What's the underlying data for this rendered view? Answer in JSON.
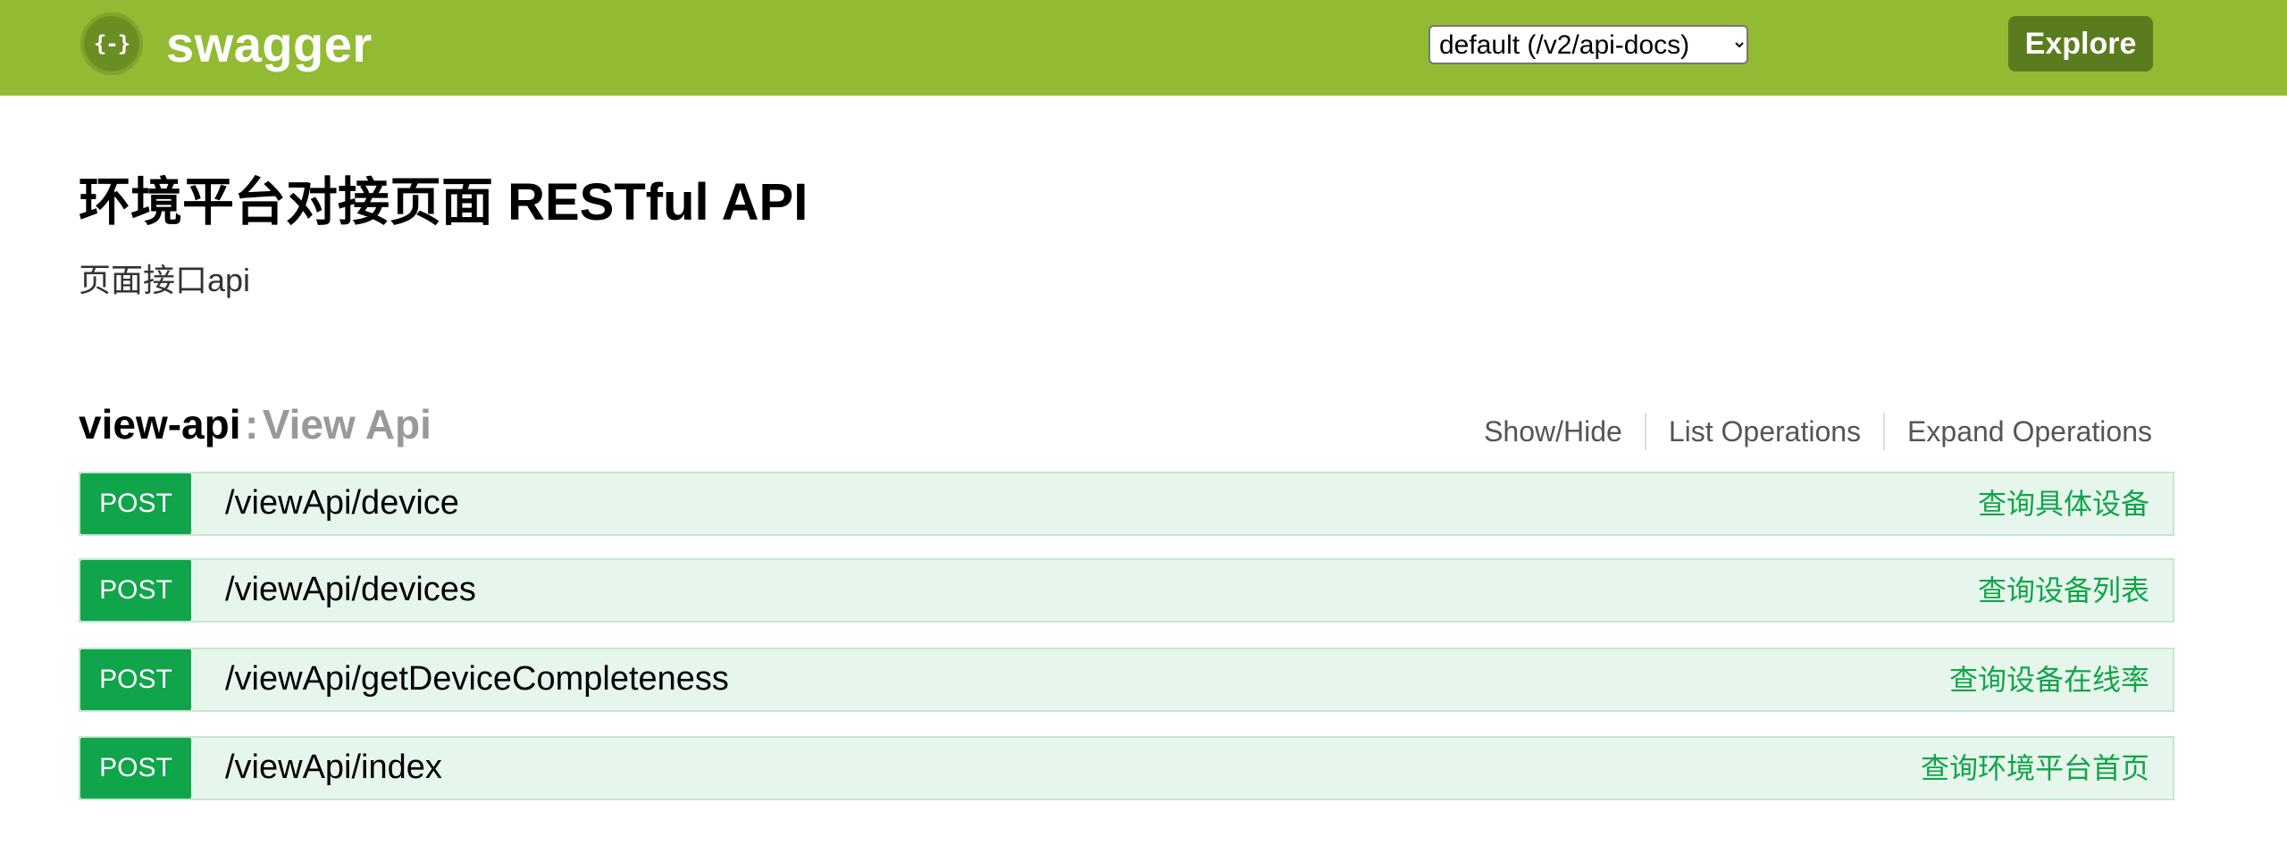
{
  "header": {
    "logo_icon_text": "{-}",
    "logo_text": "swagger",
    "spec_select": {
      "selected": "default (/v2/api-docs)",
      "options": [
        "default (/v2/api-docs)"
      ]
    },
    "explore_label": "Explore",
    "colors": {
      "bar": "#92bb33",
      "explore_button": "#5b7c1e"
    }
  },
  "info": {
    "title": "环境平台对接页面 RESTful API",
    "description": "页面接口api"
  },
  "resource": {
    "name": "view-api",
    "separator": ":",
    "description": "View Api",
    "controls": {
      "show_hide": "Show/Hide",
      "list_operations": "List Operations",
      "expand_operations": "Expand Operations"
    }
  },
  "operations": [
    {
      "method": "POST",
      "path": "/viewApi/device",
      "summary": "查询具体设备"
    },
    {
      "method": "POST",
      "path": "/viewApi/devices",
      "summary": "查询设备列表"
    },
    {
      "method": "POST",
      "path": "/viewApi/getDeviceCompleteness",
      "summary": "查询设备在线率"
    },
    {
      "method": "POST",
      "path": "/viewApi/index",
      "summary": "查询环境平台首页"
    }
  ],
  "colors": {
    "post_method": "#10a54a",
    "post_background": "#e7f6ec",
    "post_border": "#c3e8d1"
  }
}
